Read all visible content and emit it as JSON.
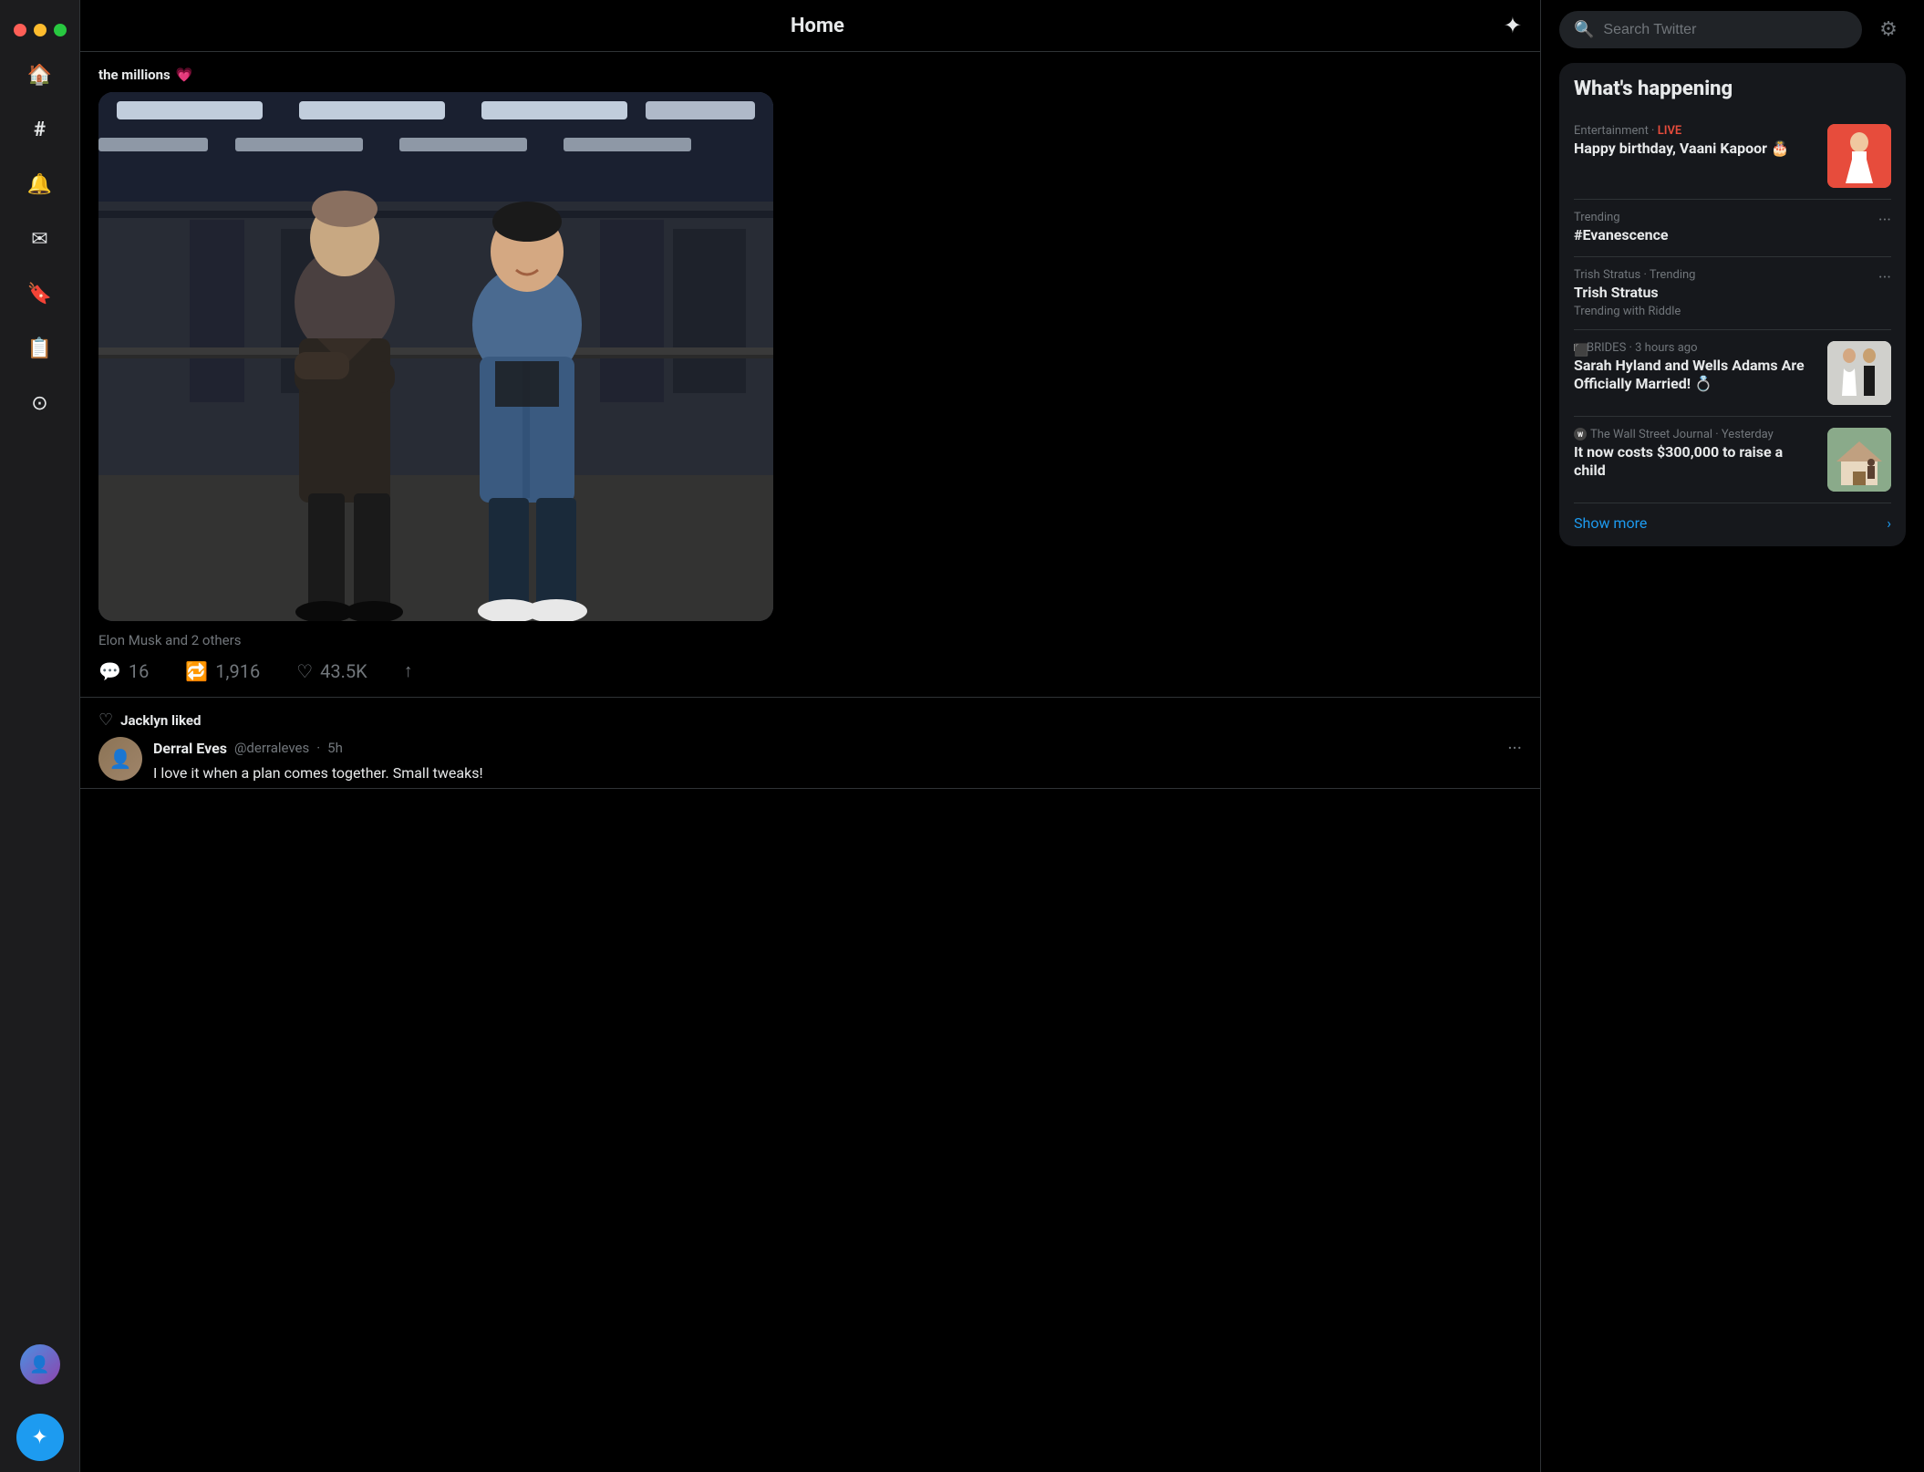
{
  "window": {
    "traffic_lights": [
      "red",
      "yellow",
      "green"
    ]
  },
  "sidebar": {
    "icons": [
      {
        "name": "home-icon",
        "symbol": "🏠",
        "label": "Home",
        "active": true
      },
      {
        "name": "explore-icon",
        "symbol": "#",
        "label": "Explore"
      },
      {
        "name": "notifications-icon",
        "symbol": "🔔",
        "label": "Notifications"
      },
      {
        "name": "messages-icon",
        "symbol": "✉",
        "label": "Messages"
      },
      {
        "name": "bookmarks-icon",
        "symbol": "🔖",
        "label": "Bookmarks"
      },
      {
        "name": "lists-icon",
        "symbol": "📋",
        "label": "Lists"
      },
      {
        "name": "circles-icon",
        "symbol": "⊙",
        "label": "Circles"
      }
    ],
    "fab_label": "✦",
    "avatar_emoji": "👤"
  },
  "feed": {
    "header": {
      "title": "Home",
      "sparkle_symbol": "✦"
    },
    "tweet": {
      "top_text_prefix": "the millions",
      "top_text_emoji": "💗",
      "caption": "Elon Musk and 2 others",
      "actions": {
        "reply": {
          "count": "16",
          "symbol": "💬"
        },
        "retweet": {
          "count": "1,916",
          "symbol": "🔁"
        },
        "like": {
          "count": "43.5K",
          "symbol": "♡"
        },
        "share": {
          "symbol": "↑"
        }
      }
    },
    "liked_tweet": {
      "liked_by": "Jacklyn liked",
      "heart_symbol": "♡",
      "author": {
        "name": "Derral Eves",
        "handle": "@derraleves",
        "time": "5h",
        "emoji": "👤"
      },
      "text": "I love it when a plan comes together. Small tweaks!",
      "more_symbol": "···"
    }
  },
  "right_sidebar": {
    "search": {
      "placeholder": "Search Twitter",
      "icon_symbol": "🔍"
    },
    "settings_symbol": "⚙",
    "whats_happening": {
      "title": "What's happening",
      "items": [
        {
          "label": "Entertainment · LIVE",
          "main_text": "Happy birthday, Vaani Kapoor 🎂",
          "has_image": true,
          "image_class": "img-vaani"
        },
        {
          "label": "Trending",
          "main_text": "#Evanescence",
          "has_image": false,
          "has_dots": true
        },
        {
          "label": "Trish Stratus · Trending",
          "main_text": "Trish Stratus",
          "sub_text": "Trending with Riddle",
          "has_image": false,
          "has_dots": true
        },
        {
          "label": "BRIDES · 3 hours ago",
          "main_text": "Sarah Hyland and Wells Adams Are Officially Married! 💍",
          "has_image": true,
          "image_class": "img-wedding"
        },
        {
          "label": "The Wall Street Journal · Yesterday",
          "main_text": "It now costs $300,000 to raise a child",
          "has_image": true,
          "image_class": "img-house"
        }
      ],
      "show_more": "Show more",
      "show_more_arrow": "›"
    }
  }
}
